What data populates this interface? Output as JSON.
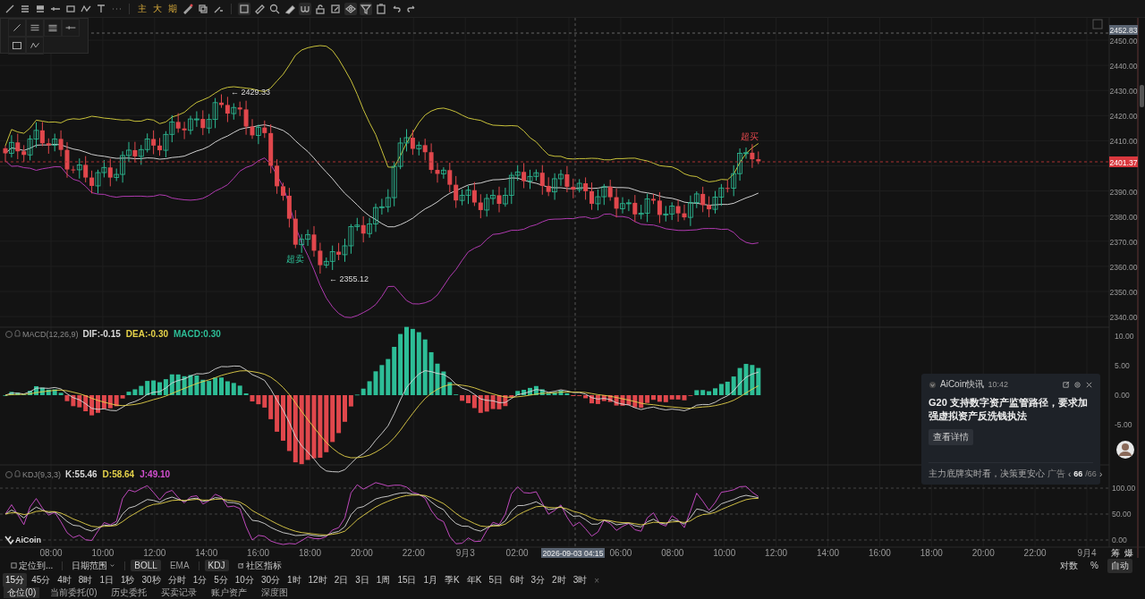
{
  "toolbar": {
    "marks": [
      "主",
      "大",
      "期"
    ]
  },
  "chart": {
    "price_axis": [
      "2450.00",
      "2440.00",
      "2430.00",
      "2420.00",
      "2410.00",
      "2390.00",
      "2380.00",
      "2370.00",
      "2360.00",
      "2350.00",
      "2340.00"
    ],
    "crosshair_price": "2452.83",
    "last_price": "2401.37",
    "high_label": "← 2429.33",
    "low_label": "← 2355.12",
    "signals": [
      {
        "text": "超买",
        "kind": "overbought"
      },
      {
        "text": "超卖",
        "kind": "oversold"
      }
    ],
    "macd": {
      "title": "MACD(12,26,9)",
      "legend": [
        {
          "text": "DIF:-0.15",
          "color": "#d9d9d9"
        },
        {
          "text": "DEA:-0.30",
          "color": "#e5d24a"
        },
        {
          "text": "MACD:0.30",
          "color": "#2dbd96"
        }
      ],
      "axis": [
        "10.00",
        "5.00",
        "0.00",
        "-5.00"
      ]
    },
    "kdj": {
      "title": "KDJ(9,3,3)",
      "legend": [
        {
          "text": "K:55.46",
          "color": "#d9d9d9"
        },
        {
          "text": "D:58.64",
          "color": "#e5d24a"
        },
        {
          "text": "J:49.10",
          "color": "#d34fd0"
        }
      ],
      "axis": [
        "100.00",
        "50.00",
        "0.00"
      ]
    },
    "time_axis": [
      {
        "label": "08:00",
        "selected": false
      },
      {
        "label": "10:00",
        "selected": false
      },
      {
        "label": "12:00",
        "selected": false
      },
      {
        "label": "14:00",
        "selected": false
      },
      {
        "label": "16:00",
        "selected": false
      },
      {
        "label": "18:00",
        "selected": false
      },
      {
        "label": "20:00",
        "selected": false
      },
      {
        "label": "22:00",
        "selected": false
      },
      {
        "label": "9月3",
        "selected": false
      },
      {
        "label": "02:00",
        "selected": false
      },
      {
        "label": "2026-09-03 04:15",
        "selected": true
      },
      {
        "label": "06:00",
        "selected": false
      },
      {
        "label": "08:00",
        "selected": false
      },
      {
        "label": "10:00",
        "selected": false
      },
      {
        "label": "12:00",
        "selected": false
      },
      {
        "label": "14:00",
        "selected": false
      },
      {
        "label": "16:00",
        "selected": false
      },
      {
        "label": "18:00",
        "selected": false
      },
      {
        "label": "20:00",
        "selected": false
      },
      {
        "label": "22:00",
        "selected": false
      },
      {
        "label": "9月4",
        "selected": false
      }
    ],
    "side_buttons": [
      "筹",
      "爆"
    ],
    "logo": "AiCoin"
  },
  "indicator_bar": {
    "locate": "定位到...",
    "date_range": "日期范围",
    "indicators": [
      {
        "label": "BOLL",
        "selected": true
      },
      {
        "label": "EMA",
        "selected": false
      },
      {
        "label": "KDJ",
        "selected": true
      }
    ],
    "community": "社区指标",
    "scale_options": [
      {
        "label": "对数",
        "selected": false
      },
      {
        "label": "%",
        "selected": false
      },
      {
        "label": "自动",
        "selected": true
      }
    ]
  },
  "timeframes": [
    {
      "label": "15分",
      "selected": true
    },
    {
      "label": "45分",
      "selected": false
    },
    {
      "label": "4时",
      "selected": false
    },
    {
      "label": "8时",
      "selected": false
    },
    {
      "label": "1日",
      "selected": false
    },
    {
      "label": "1秒",
      "selected": false
    },
    {
      "label": "30秒",
      "selected": false
    },
    {
      "label": "分时",
      "selected": false
    },
    {
      "label": "1分",
      "selected": false
    },
    {
      "label": "5分",
      "selected": false
    },
    {
      "label": "10分",
      "selected": false
    },
    {
      "label": "30分",
      "selected": false
    },
    {
      "label": "1时",
      "selected": false
    },
    {
      "label": "12时",
      "selected": false
    },
    {
      "label": "2日",
      "selected": false
    },
    {
      "label": "3日",
      "selected": false
    },
    {
      "label": "1周",
      "selected": false
    },
    {
      "label": "15日",
      "selected": false
    },
    {
      "label": "1月",
      "selected": false
    },
    {
      "label": "季K",
      "selected": false
    },
    {
      "label": "年K",
      "selected": false
    },
    {
      "label": "5日",
      "selected": false
    },
    {
      "label": "6时",
      "selected": false
    },
    {
      "label": "3分",
      "selected": false
    },
    {
      "label": "2时",
      "selected": false
    },
    {
      "label": "3时",
      "selected": false
    }
  ],
  "timeframes_close": "×",
  "bottom_tabs": [
    {
      "label": "仓位(0)",
      "selected": true
    },
    {
      "label": "当前委托(0)",
      "selected": false
    },
    {
      "label": "历史委托",
      "selected": false
    },
    {
      "label": "买卖记录",
      "selected": false
    },
    {
      "label": "账户资产",
      "selected": false
    },
    {
      "label": "深度图",
      "selected": false
    }
  ],
  "news_popup": {
    "source": "AiCoin快讯",
    "time": "10:42",
    "headline": "G20 支持数字资产监管路径，要求加强虚拟资产反洗钱执法",
    "button": "查看详情",
    "ad_text": "主力底牌实时看，决策更安心",
    "ad_tag": "广告",
    "prev": "‹",
    "page": "66",
    "total": "/66",
    "next": "›"
  }
}
